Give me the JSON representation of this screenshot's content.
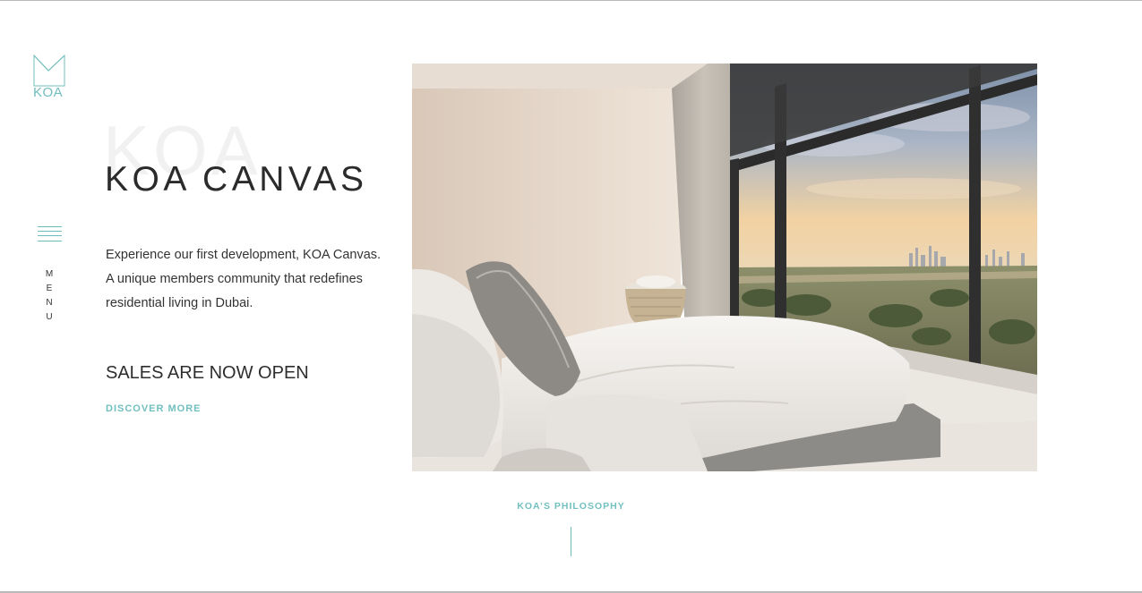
{
  "brand": {
    "logo_text": "KOA",
    "accent_color": "#72bfbf"
  },
  "menu": {
    "letters": [
      "M",
      "E",
      "N",
      "U"
    ],
    "icon": "hamburger-icon"
  },
  "hero_text": {
    "background_word": "KOA",
    "title": "KOA CANVAS",
    "description_lines": [
      "Experience our first development, KOA Canvas.",
      "A unique members community that redefines",
      "residential living in Dubai."
    ],
    "sales_heading": "SALES ARE NOW OPEN",
    "cta_label": "DISCOVER MORE"
  },
  "hero_image": {
    "subject": "bedroom-with-city-view"
  },
  "philosophy": {
    "label": "KOA’S PHILOSOPHY"
  }
}
